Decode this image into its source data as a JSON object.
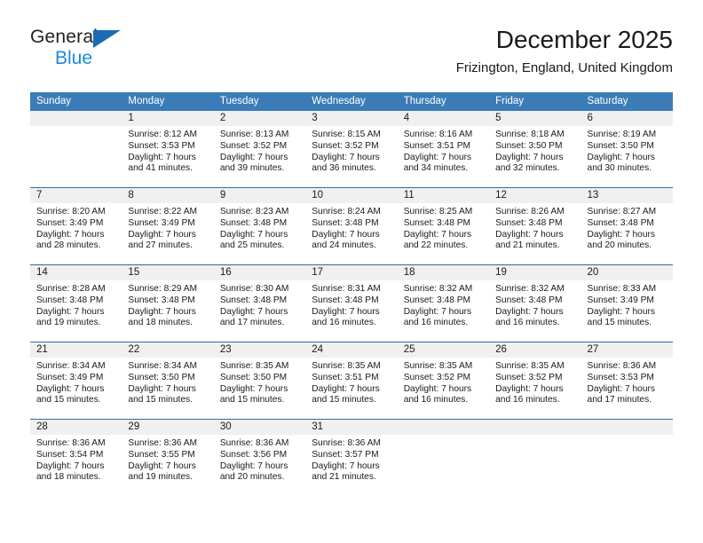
{
  "brand": {
    "line1": "General",
    "line2": "Blue",
    "flag_icon": "blue-triangle-flag",
    "accent_dark": "#1b6cb5",
    "accent_light": "#1b8adb"
  },
  "header": {
    "title": "December 2025",
    "subtitle": "Frizington, England, United Kingdom"
  },
  "colors": {
    "header_bar": "#3b7cb8",
    "week_divider": "#2c6ca8",
    "daynum_band": "#f0f0f0",
    "text": "#1a1a1a"
  },
  "labels": {
    "sunrise_prefix": "Sunrise:",
    "sunset_prefix": "Sunset:",
    "daylight_prefix": "Daylight:"
  },
  "weekdays": [
    "Sunday",
    "Monday",
    "Tuesday",
    "Wednesday",
    "Thursday",
    "Friday",
    "Saturday"
  ],
  "weeks": [
    [
      {
        "day": "",
        "sunrise": "",
        "sunset": "",
        "daylight_1": "",
        "daylight_2": ""
      },
      {
        "day": "1",
        "sunrise": "Sunrise: 8:12 AM",
        "sunset": "Sunset: 3:53 PM",
        "daylight_1": "Daylight: 7 hours",
        "daylight_2": "and 41 minutes."
      },
      {
        "day": "2",
        "sunrise": "Sunrise: 8:13 AM",
        "sunset": "Sunset: 3:52 PM",
        "daylight_1": "Daylight: 7 hours",
        "daylight_2": "and 39 minutes."
      },
      {
        "day": "3",
        "sunrise": "Sunrise: 8:15 AM",
        "sunset": "Sunset: 3:52 PM",
        "daylight_1": "Daylight: 7 hours",
        "daylight_2": "and 36 minutes."
      },
      {
        "day": "4",
        "sunrise": "Sunrise: 8:16 AM",
        "sunset": "Sunset: 3:51 PM",
        "daylight_1": "Daylight: 7 hours",
        "daylight_2": "and 34 minutes."
      },
      {
        "day": "5",
        "sunrise": "Sunrise: 8:18 AM",
        "sunset": "Sunset: 3:50 PM",
        "daylight_1": "Daylight: 7 hours",
        "daylight_2": "and 32 minutes."
      },
      {
        "day": "6",
        "sunrise": "Sunrise: 8:19 AM",
        "sunset": "Sunset: 3:50 PM",
        "daylight_1": "Daylight: 7 hours",
        "daylight_2": "and 30 minutes."
      }
    ],
    [
      {
        "day": "7",
        "sunrise": "Sunrise: 8:20 AM",
        "sunset": "Sunset: 3:49 PM",
        "daylight_1": "Daylight: 7 hours",
        "daylight_2": "and 28 minutes."
      },
      {
        "day": "8",
        "sunrise": "Sunrise: 8:22 AM",
        "sunset": "Sunset: 3:49 PM",
        "daylight_1": "Daylight: 7 hours",
        "daylight_2": "and 27 minutes."
      },
      {
        "day": "9",
        "sunrise": "Sunrise: 8:23 AM",
        "sunset": "Sunset: 3:48 PM",
        "daylight_1": "Daylight: 7 hours",
        "daylight_2": "and 25 minutes."
      },
      {
        "day": "10",
        "sunrise": "Sunrise: 8:24 AM",
        "sunset": "Sunset: 3:48 PM",
        "daylight_1": "Daylight: 7 hours",
        "daylight_2": "and 24 minutes."
      },
      {
        "day": "11",
        "sunrise": "Sunrise: 8:25 AM",
        "sunset": "Sunset: 3:48 PM",
        "daylight_1": "Daylight: 7 hours",
        "daylight_2": "and 22 minutes."
      },
      {
        "day": "12",
        "sunrise": "Sunrise: 8:26 AM",
        "sunset": "Sunset: 3:48 PM",
        "daylight_1": "Daylight: 7 hours",
        "daylight_2": "and 21 minutes."
      },
      {
        "day": "13",
        "sunrise": "Sunrise: 8:27 AM",
        "sunset": "Sunset: 3:48 PM",
        "daylight_1": "Daylight: 7 hours",
        "daylight_2": "and 20 minutes."
      }
    ],
    [
      {
        "day": "14",
        "sunrise": "Sunrise: 8:28 AM",
        "sunset": "Sunset: 3:48 PM",
        "daylight_1": "Daylight: 7 hours",
        "daylight_2": "and 19 minutes."
      },
      {
        "day": "15",
        "sunrise": "Sunrise: 8:29 AM",
        "sunset": "Sunset: 3:48 PM",
        "daylight_1": "Daylight: 7 hours",
        "daylight_2": "and 18 minutes."
      },
      {
        "day": "16",
        "sunrise": "Sunrise: 8:30 AM",
        "sunset": "Sunset: 3:48 PM",
        "daylight_1": "Daylight: 7 hours",
        "daylight_2": "and 17 minutes."
      },
      {
        "day": "17",
        "sunrise": "Sunrise: 8:31 AM",
        "sunset": "Sunset: 3:48 PM",
        "daylight_1": "Daylight: 7 hours",
        "daylight_2": "and 16 minutes."
      },
      {
        "day": "18",
        "sunrise": "Sunrise: 8:32 AM",
        "sunset": "Sunset: 3:48 PM",
        "daylight_1": "Daylight: 7 hours",
        "daylight_2": "and 16 minutes."
      },
      {
        "day": "19",
        "sunrise": "Sunrise: 8:32 AM",
        "sunset": "Sunset: 3:48 PM",
        "daylight_1": "Daylight: 7 hours",
        "daylight_2": "and 16 minutes."
      },
      {
        "day": "20",
        "sunrise": "Sunrise: 8:33 AM",
        "sunset": "Sunset: 3:49 PM",
        "daylight_1": "Daylight: 7 hours",
        "daylight_2": "and 15 minutes."
      }
    ],
    [
      {
        "day": "21",
        "sunrise": "Sunrise: 8:34 AM",
        "sunset": "Sunset: 3:49 PM",
        "daylight_1": "Daylight: 7 hours",
        "daylight_2": "and 15 minutes."
      },
      {
        "day": "22",
        "sunrise": "Sunrise: 8:34 AM",
        "sunset": "Sunset: 3:50 PM",
        "daylight_1": "Daylight: 7 hours",
        "daylight_2": "and 15 minutes."
      },
      {
        "day": "23",
        "sunrise": "Sunrise: 8:35 AM",
        "sunset": "Sunset: 3:50 PM",
        "daylight_1": "Daylight: 7 hours",
        "daylight_2": "and 15 minutes."
      },
      {
        "day": "24",
        "sunrise": "Sunrise: 8:35 AM",
        "sunset": "Sunset: 3:51 PM",
        "daylight_1": "Daylight: 7 hours",
        "daylight_2": "and 15 minutes."
      },
      {
        "day": "25",
        "sunrise": "Sunrise: 8:35 AM",
        "sunset": "Sunset: 3:52 PM",
        "daylight_1": "Daylight: 7 hours",
        "daylight_2": "and 16 minutes."
      },
      {
        "day": "26",
        "sunrise": "Sunrise: 8:35 AM",
        "sunset": "Sunset: 3:52 PM",
        "daylight_1": "Daylight: 7 hours",
        "daylight_2": "and 16 minutes."
      },
      {
        "day": "27",
        "sunrise": "Sunrise: 8:36 AM",
        "sunset": "Sunset: 3:53 PM",
        "daylight_1": "Daylight: 7 hours",
        "daylight_2": "and 17 minutes."
      }
    ],
    [
      {
        "day": "28",
        "sunrise": "Sunrise: 8:36 AM",
        "sunset": "Sunset: 3:54 PM",
        "daylight_1": "Daylight: 7 hours",
        "daylight_2": "and 18 minutes."
      },
      {
        "day": "29",
        "sunrise": "Sunrise: 8:36 AM",
        "sunset": "Sunset: 3:55 PM",
        "daylight_1": "Daylight: 7 hours",
        "daylight_2": "and 19 minutes."
      },
      {
        "day": "30",
        "sunrise": "Sunrise: 8:36 AM",
        "sunset": "Sunset: 3:56 PM",
        "daylight_1": "Daylight: 7 hours",
        "daylight_2": "and 20 minutes."
      },
      {
        "day": "31",
        "sunrise": "Sunrise: 8:36 AM",
        "sunset": "Sunset: 3:57 PM",
        "daylight_1": "Daylight: 7 hours",
        "daylight_2": "and 21 minutes."
      },
      {
        "day": "",
        "sunrise": "",
        "sunset": "",
        "daylight_1": "",
        "daylight_2": ""
      },
      {
        "day": "",
        "sunrise": "",
        "sunset": "",
        "daylight_1": "",
        "daylight_2": ""
      },
      {
        "day": "",
        "sunrise": "",
        "sunset": "",
        "daylight_1": "",
        "daylight_2": ""
      }
    ]
  ]
}
